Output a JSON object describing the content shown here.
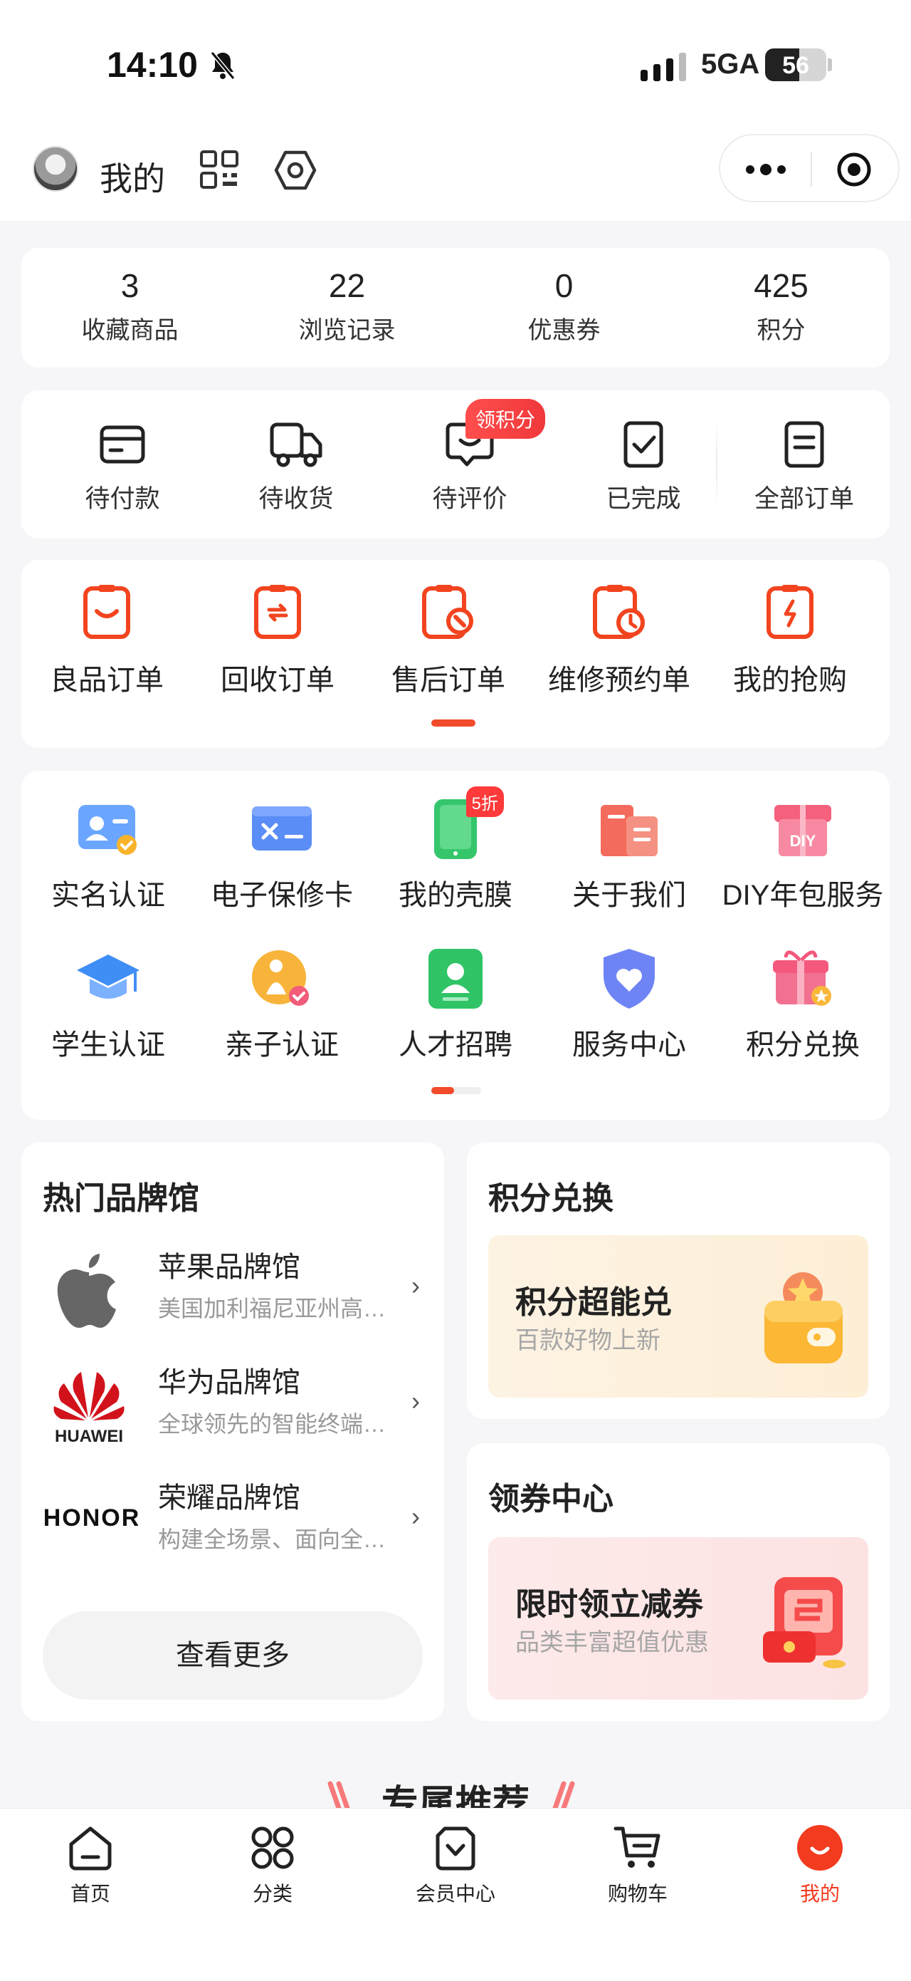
{
  "status_bar": {
    "time": "14:10",
    "network": "5GA",
    "battery": "56",
    "battery_level": 0.56
  },
  "header": {
    "title": "我的",
    "icons": [
      "avatar",
      "qr-code-icon",
      "settings-icon",
      "more-icon",
      "close-icon"
    ]
  },
  "stats": [
    {
      "value": "3",
      "label": "收藏商品"
    },
    {
      "value": "22",
      "label": "浏览记录"
    },
    {
      "value": "0",
      "label": "优惠券"
    },
    {
      "value": "425",
      "label": "积分"
    }
  ],
  "orders": {
    "items": [
      {
        "label": "待付款",
        "icon": "wallet-icon"
      },
      {
        "label": "待收货",
        "icon": "truck-icon"
      },
      {
        "label": "待评价",
        "icon": "comment-icon"
      },
      {
        "label": "已完成",
        "icon": "check-clipboard-icon"
      },
      {
        "label": "全部订单",
        "icon": "orders-list-icon"
      }
    ],
    "badge": "领积分"
  },
  "sub_orders": [
    {
      "label": "良品订单"
    },
    {
      "label": "回收订单"
    },
    {
      "label": "售后订单"
    },
    {
      "label": "维修预约单"
    },
    {
      "label": "我的抢购"
    }
  ],
  "services": {
    "row1": [
      {
        "label": "实名认证",
        "icon": "id-card-icon",
        "color": "#4b8ff7"
      },
      {
        "label": "电子保修卡",
        "icon": "warranty-card-icon",
        "color": "#5a8df5"
      },
      {
        "label": "我的壳膜",
        "icon": "phone-case-icon",
        "color": "#35c66c",
        "badge": "5折"
      },
      {
        "label": "关于我们",
        "icon": "building-icon",
        "color": "#f05a4c"
      },
      {
        "label": "DIY年包服务",
        "icon": "diy-box-icon",
        "color": "#f35c7f",
        "icon_text": "DIY"
      }
    ],
    "row2": [
      {
        "label": "学生认证",
        "icon": "graduation-cap-icon",
        "color": "#3f8ef5"
      },
      {
        "label": "亲子认证",
        "icon": "parent-child-icon",
        "color": "#f5a623"
      },
      {
        "label": "人才招聘",
        "icon": "recruit-icon",
        "color": "#30c467"
      },
      {
        "label": "服务中心",
        "icon": "heart-shield-icon",
        "color": "#6e7ff5"
      },
      {
        "label": "积分兑换",
        "icon": "gift-icon",
        "color": "#f2607a"
      }
    ]
  },
  "brands": {
    "title": "热门品牌馆",
    "items": [
      {
        "name": "苹果品牌馆",
        "desc": "美国加利福尼亚州高科技公司",
        "logo": "apple-logo"
      },
      {
        "name": "华为品牌馆",
        "desc": "全球领先的智能终端提供商",
        "logo": "huawei-logo",
        "logo_text": "HUAWEI"
      },
      {
        "name": "荣耀品牌馆",
        "desc": "构建全场景、面向全球的智能终端",
        "logo": "honor-logo",
        "logo_text": "HONOR"
      }
    ],
    "more_label": "查看更多"
  },
  "points_exchange": {
    "title": "积分兑换",
    "headline": "积分超能兑",
    "subline": "百款好物上新"
  },
  "coupon_center": {
    "title": "领券中心",
    "headline": "限时领立减券",
    "subline": "品类丰富超值优惠"
  },
  "recommend": {
    "title": "专属推荐"
  },
  "tabbar": [
    {
      "label": "首页",
      "icon": "home-icon"
    },
    {
      "label": "分类",
      "icon": "category-icon"
    },
    {
      "label": "会员中心",
      "icon": "member-bag-icon"
    },
    {
      "label": "购物车",
      "icon": "cart-icon"
    },
    {
      "label": "我的",
      "icon": "profile-icon",
      "active": true
    }
  ],
  "colors": {
    "accent": "#f23b1f",
    "background": "#f6f6f8"
  }
}
